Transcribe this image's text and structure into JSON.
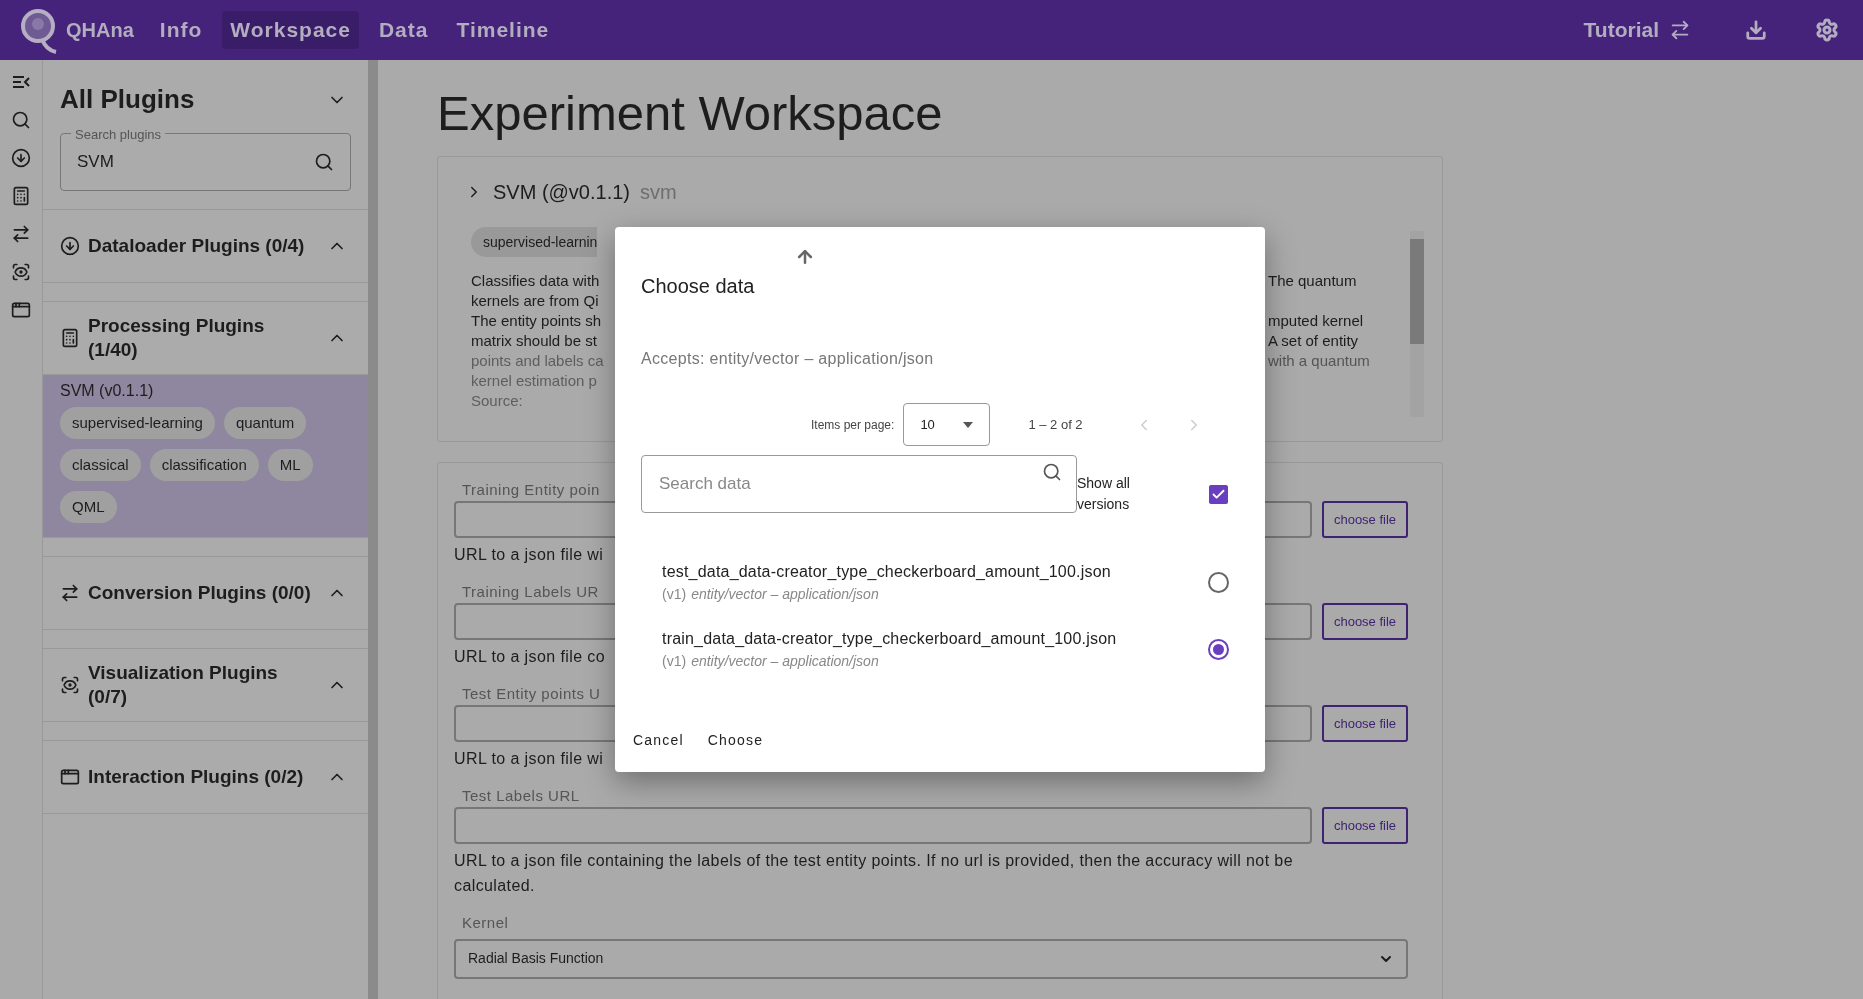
{
  "topbar": {
    "brand": "QHAna",
    "nav": [
      {
        "label": "Info",
        "selected": false
      },
      {
        "label": "Workspace",
        "selected": true
      },
      {
        "label": "Data",
        "selected": false
      },
      {
        "label": "Timeline",
        "selected": false
      }
    ],
    "tutorial": "Tutorial"
  },
  "sidebar": {
    "title": "All Plugins",
    "search": {
      "label": "Search plugins",
      "value": "SVM"
    },
    "groups": [
      {
        "kind": "dataloader",
        "title": "Dataloader Plugins (0/4)",
        "expanded": true
      },
      {
        "kind": "processing",
        "title": "Processing Plugins (1/40)",
        "expanded": true,
        "plugins": [
          {
            "name": "SVM (v0.1.1)",
            "selected": true,
            "tags": [
              "supervised-learning",
              "quantum",
              "classical",
              "classification",
              "ML",
              "QML"
            ]
          }
        ]
      },
      {
        "kind": "conversion",
        "title": "Conversion Plugins (0/0)",
        "expanded": true
      },
      {
        "kind": "visualization",
        "title": "Visualization Plugins (0/7)",
        "expanded": true
      },
      {
        "kind": "interaction",
        "title": "Interaction Plugins (0/2)",
        "expanded": true
      }
    ]
  },
  "main": {
    "title": "Experiment Workspace",
    "plugin_card": {
      "name": "SVM (@v0.1.1)",
      "id": "svm",
      "tag": "supervised-learnin",
      "description": [
        {
          "left": "Classifies data with",
          "right": "The quantum"
        },
        {
          "left": "kernels are from Qi"
        },
        {
          "left": "The entity points sh",
          "right": "mputed kernel"
        },
        {
          "left": "matrix should be st",
          "right": "A set of entity"
        },
        {
          "left": "points and labels ca",
          "right": "with a quantum"
        },
        {
          "left": "kernel estimation p"
        },
        {
          "left": "Source:"
        }
      ]
    },
    "form": {
      "fields": [
        {
          "label": "Training Entity poin",
          "help": "URL to a json file wi",
          "button": "choose file"
        },
        {
          "label": "Training Labels UR",
          "help": "URL to a json file co",
          "button": "choose file"
        },
        {
          "label": "Test Entity points U",
          "help": "URL to a json file wi",
          "button": "choose file"
        },
        {
          "label": "Test Labels URL",
          "help": "URL to a json file containing the labels of the test entity points. If no url is provided, then the accuracy will not be calculated.",
          "button": "choose file"
        }
      ],
      "kernel": {
        "label": "Kernel",
        "value": "Radial Basis Function"
      }
    }
  },
  "dialog": {
    "title": "Choose data",
    "accepts": "Accepts: entity/vector – application/json",
    "pagination": {
      "label": "Items per page:",
      "per_page": "10",
      "range": "1 – 2 of 2",
      "prev": {
        "disabled": true
      },
      "next": {
        "disabled": true
      }
    },
    "search": {
      "placeholder": "Search data"
    },
    "show_all_versions": {
      "label": "Show all versions",
      "checked": true
    },
    "items": [
      {
        "name": "test_data_data-creator_type_checkerboard_amount_100.json",
        "version": "(v1)",
        "type": "entity/vector – application/json",
        "selected": false
      },
      {
        "name": "train_data_data-creator_type_checkerboard_amount_100.json",
        "version": "(v1)",
        "type": "entity/vector – application/json",
        "selected": true
      }
    ],
    "actions": [
      "Cancel",
      "Choose"
    ]
  }
}
